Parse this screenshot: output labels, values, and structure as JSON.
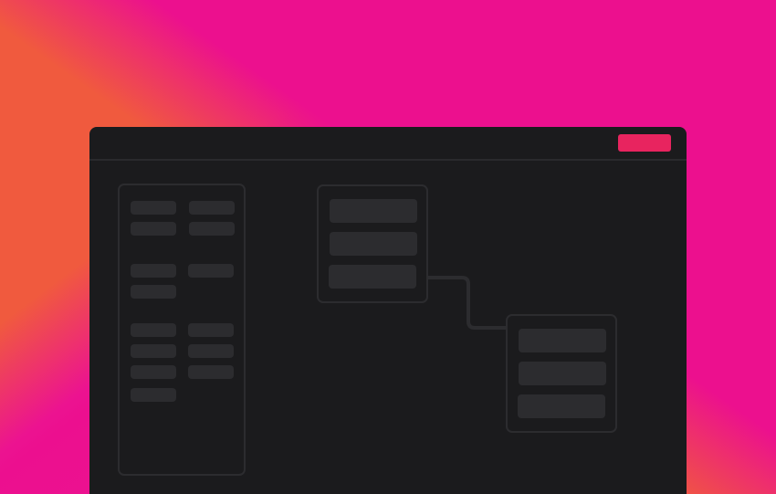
{
  "colors": {
    "accent": "#e8245f",
    "window_bg": "#1b1b1d",
    "placeholder": "#2c2c2f"
  },
  "toolbar": {
    "primary_label": ""
  },
  "sidebar": {
    "items": [
      {
        "label": ""
      },
      {
        "label": ""
      },
      {
        "label": ""
      },
      {
        "label": ""
      },
      {
        "label": ""
      },
      {
        "label": ""
      },
      {
        "label": ""
      },
      {
        "label": ""
      },
      {
        "label": ""
      },
      {
        "label": ""
      },
      {
        "label": ""
      },
      {
        "label": ""
      },
      {
        "label": ""
      }
    ]
  },
  "nodes": [
    {
      "rows": [
        {
          "label": ""
        },
        {
          "label": ""
        },
        {
          "label": ""
        }
      ]
    },
    {
      "rows": [
        {
          "label": ""
        },
        {
          "label": ""
        },
        {
          "label": ""
        }
      ]
    }
  ]
}
